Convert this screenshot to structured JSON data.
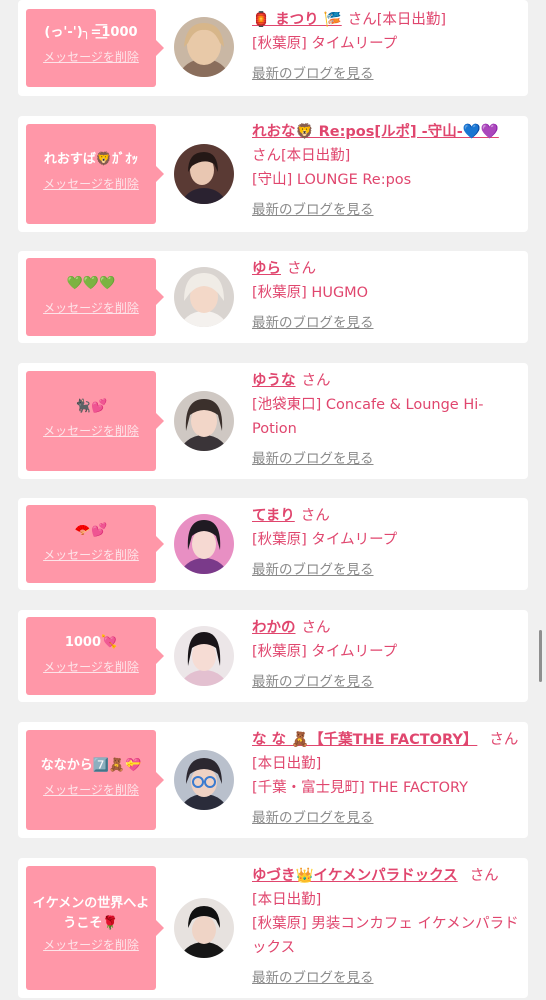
{
  "delete_label": "メッセージを削除",
  "blog_label": "最新のブログを見る",
  "san_label": "さん",
  "status_on": "[本日出勤]",
  "colors": {
    "bubble": "#ff97a8",
    "accent": "#e0466e",
    "muted": "#8a8a8a"
  },
  "cards": [
    {
      "message": "(っ'-')╮=͟͟͞͞1000",
      "name": "🏮 まつり 🎏",
      "status": "[本日出勤]",
      "shop": "[秋葉原] タイムリープ"
    },
    {
      "message": "れおすば🦁ｶﾞｵｯ",
      "name": "れおな🦁 Re:pos[ルポ] -守山-💙💜",
      "status": "[本日出勤]",
      "shop": "[守山] LOUNGE Re:pos"
    },
    {
      "message": "💚💚💚",
      "name": "ゆら",
      "status": "",
      "shop": "[秋葉原] HUGMO"
    },
    {
      "message": "🐈‍⬛💕",
      "name": "ゆうな",
      "status": "",
      "shop": "[池袋東口] Concafe & Lounge Hi-Potion"
    },
    {
      "message": "🪭💕",
      "name": "てまり",
      "status": "",
      "shop": "[秋葉原] タイムリープ"
    },
    {
      "message": "1000💘",
      "name": "わかの",
      "status": "",
      "shop": "[秋葉原] タイムリープ"
    },
    {
      "message": "ななから7️⃣🧸💝",
      "name": "な な 🧸【千葉THE FACTORY】",
      "status": "[本日出勤]",
      "shop": "[千葉・富士見町] THE FACTORY"
    },
    {
      "message": "イケメンの世界へようこそ🌹",
      "name": "ゆづき👑イケメンパラドックス",
      "status": "[本日出勤]",
      "shop": "[秋葉原] 男装コンカフェ イケメンパラドックス"
    }
  ]
}
